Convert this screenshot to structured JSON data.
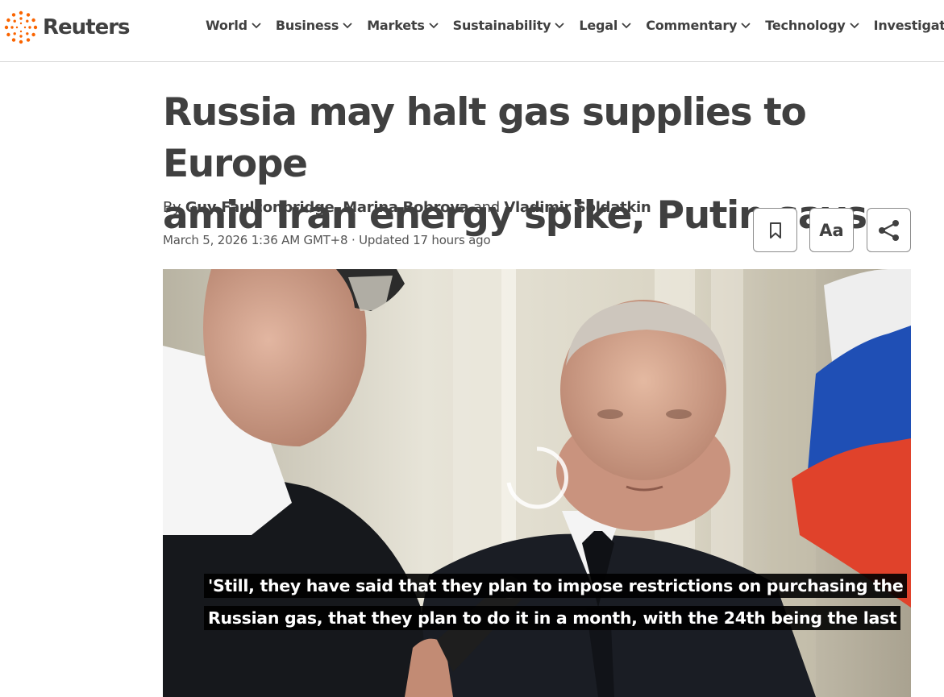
{
  "brand": {
    "name": "Reuters",
    "accent": "#fa6400"
  },
  "nav": [
    {
      "label": "World"
    },
    {
      "label": "Business"
    },
    {
      "label": "Markets"
    },
    {
      "label": "Sustainability"
    },
    {
      "label": "Legal"
    },
    {
      "label": "Commentary"
    },
    {
      "label": "Technology"
    },
    {
      "label": "Investigations"
    }
  ],
  "article": {
    "headline_line1": "Russia may halt gas supplies to Europe",
    "headline_line2": "amid Iran energy spike, Putin says",
    "by": "By",
    "authors": [
      "Guy Faulconbridge",
      "Marina Bobrova",
      "Vladimir Soldatkin"
    ],
    "sep_comma": ",",
    "sep_and": "and",
    "published": "March 5, 2026 1:36 AM GMT+8",
    "separator": "·",
    "updated": "Updated 17 hours ago"
  },
  "tools": {
    "bookmark_icon": "bookmark-icon",
    "text_size_label": "Aa",
    "share_icon": "share-icon"
  },
  "video": {
    "caption_line1": "'Still, they have said that they plan to impose restrictions on purchasing the",
    "caption_line2": "Russian gas, that they plan to do it in a month, with the 24th being the last"
  }
}
